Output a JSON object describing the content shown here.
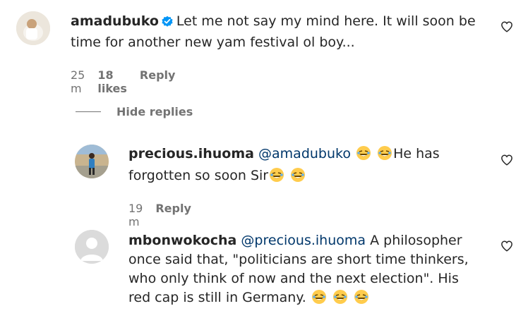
{
  "comments": [
    {
      "username": "amadubuko",
      "verified": true,
      "text": "Let me not say my mind here. It will soon be time for another new yam festival ol boy...",
      "time": "25 m",
      "likes": "18 likes",
      "reply_label": "Reply"
    },
    {
      "username": "precious.ihuoma",
      "mention": "@amadubuko",
      "text_before": "He has forgotten so soon Sir",
      "time": "19 m",
      "reply_label": "Reply"
    },
    {
      "username": "mbonwokocha",
      "mention": "@precious.ihuoma",
      "text": "A philosopher once said that, \"politicians are short time thinkers, who only think of now and the next election\". His red cap is still in Germany.",
      "reply_label": "Reply"
    }
  ],
  "hide_replies_label": "Hide replies",
  "icons": {
    "like": "heart-outline-icon",
    "verified": "verified-badge-icon",
    "emoji": "rofl-emoji"
  },
  "colors": {
    "text": "#262626",
    "muted": "#737373",
    "mention": "#00376b",
    "verified": "#0095f6"
  }
}
